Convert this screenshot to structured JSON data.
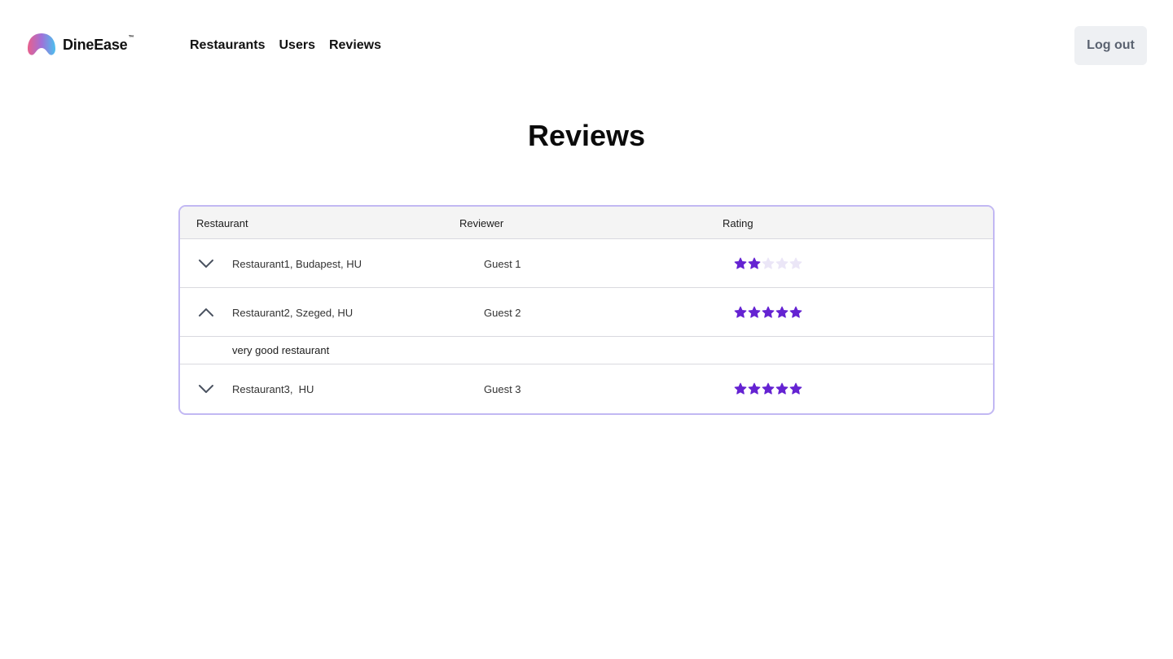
{
  "brand": {
    "name": "DineEase",
    "tm": "™"
  },
  "nav": {
    "restaurants": "Restaurants",
    "users": "Users",
    "reviews": "Reviews"
  },
  "header": {
    "logout_label": "Log out"
  },
  "page": {
    "title": "Reviews"
  },
  "table": {
    "columns": {
      "restaurant": "Restaurant",
      "reviewer": "Reviewer",
      "rating": "Rating"
    },
    "max_rating": 5,
    "rows": [
      {
        "restaurant": "Restaurant1, Budapest, HU",
        "reviewer": "Guest 1",
        "rating": 2,
        "expanded": false
      },
      {
        "restaurant": "Restaurant2, Szeged, HU",
        "reviewer": "Guest 2",
        "rating": 5,
        "expanded": true,
        "comment": "very good restaurant"
      },
      {
        "restaurant": "Restaurant3,  HU",
        "reviewer": "Guest 3",
        "rating": 5,
        "expanded": false
      }
    ]
  },
  "colors": {
    "star_filled": "#6523d2",
    "star_empty": "#ebe6f7",
    "card_border": "#c2b8f3",
    "logout_bg": "#eef0f3"
  },
  "icons": {
    "expand": "chevron-down-icon",
    "collapse": "chevron-up-icon",
    "rating": "star-icon"
  }
}
